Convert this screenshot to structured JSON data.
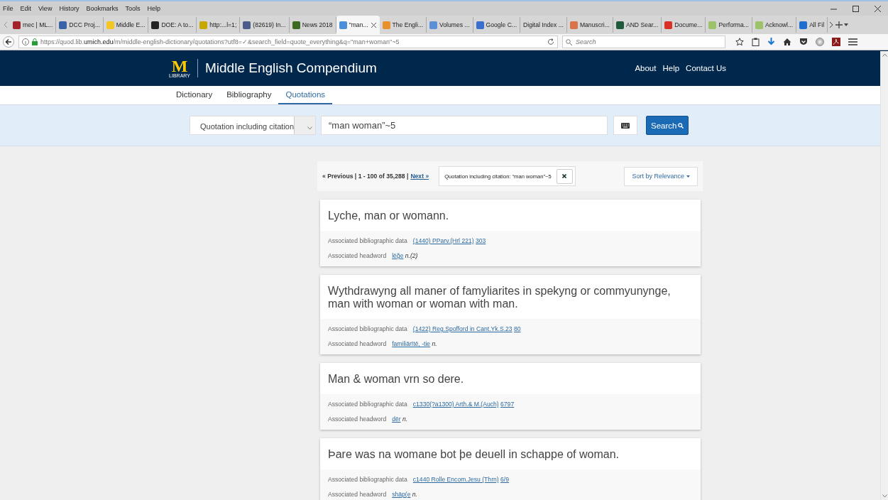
{
  "menu_bar": [
    "File",
    "Edit",
    "View",
    "History",
    "Bookmarks",
    "Tools",
    "Help"
  ],
  "browser_tabs": [
    {
      "label": "mec | ML...",
      "selected": false,
      "color": "#a3232b"
    },
    {
      "label": "DCC Proj...",
      "selected": false,
      "color": "#3a62a8"
    },
    {
      "label": "Middle E...",
      "selected": false,
      "color": "#f3c623"
    },
    {
      "label": "DOE: A to...",
      "selected": false,
      "color": "#222222"
    },
    {
      "label": "http:...l=1;",
      "selected": false,
      "color": "#c8a800"
    },
    {
      "label": "(82619) In...",
      "selected": false,
      "color": "#4a5c8c"
    },
    {
      "label": "News 2018",
      "selected": false,
      "color": "#3d6b1f"
    },
    {
      "label": "\"man...",
      "selected": true,
      "color": "#4a90d9"
    },
    {
      "label": "The Engli...",
      "selected": false,
      "color": "#e8902a"
    },
    {
      "label": "Volumes ...",
      "selected": false,
      "color": "#5b8fd6"
    },
    {
      "label": "Google C...",
      "selected": false,
      "color": "#3b6fcf"
    },
    {
      "label": "Digital Index ...",
      "selected": false
    },
    {
      "label": "Manuscri...",
      "selected": false,
      "color": "#d9734a"
    },
    {
      "label": "AND Sear...",
      "selected": false,
      "color": "#1f5a3a"
    },
    {
      "label": "Docume...",
      "selected": false,
      "color": "#d93025"
    },
    {
      "label": "Performa...",
      "selected": false,
      "color": "#9cc36a"
    },
    {
      "label": "Acknowl...",
      "selected": false,
      "color": "#9cc36a"
    },
    {
      "label": "All Fil",
      "selected": false,
      "color": "#1c6fd1"
    }
  ],
  "address_bar": {
    "url": "https://quod.lib.**umich.edu**/m/middle-english-dictionary/quotations?utf8=✓&search_field=quote_everything&q=\"man+woman\"~5"
  },
  "browser_search": {
    "placeholder": "Search"
  },
  "site_header": {
    "logo_letter": "M",
    "logo_caption": "LIBRARY",
    "title": "Middle English Compendium",
    "links": [
      "About",
      "Help",
      "Contact Us"
    ]
  },
  "site_nav": [
    {
      "label": "Dictionary",
      "selected": false
    },
    {
      "label": "Bibliography",
      "selected": false
    },
    {
      "label": "Quotations",
      "selected": true
    }
  ],
  "search": {
    "field_select": "Quotation including citation",
    "query": "“man woman”~5",
    "button": "Search"
  },
  "pager": {
    "status": "« Previous | 1 - 100 of 35,288 |",
    "next": "Next »",
    "filter": "Quotation including citation: “man woman”~5",
    "sort": "Sort by Relevance"
  },
  "results": [
    {
      "quote": "Lyche, man or womann.",
      "biblio_label": "Associated bibliographic data",
      "biblio_link": "(1440) PParv.(Hrl 221)",
      "biblio_page": "303",
      "headword_label": "Associated headword",
      "headword": "lēğe",
      "headword_pos": "n.(2)"
    },
    {
      "quote": "Wythdrawyng all maner of famyliarites in spekyng or commyunynge, man with woman or woman with man.",
      "biblio_label": "Associated bibliographic data",
      "biblio_link": "(1422) Reg.Spofford in Cant.Yk.S.23",
      "biblio_page": "80",
      "headword_label": "Associated headword",
      "headword": "familiārītē, -tie",
      "headword_pos": "n."
    },
    {
      "quote": "Man & woman vrn so dere.",
      "biblio_label": "Associated bibliographic data",
      "biblio_link": "c1330(?a1300) Arth.& M.(Auch)",
      "biblio_page": "6797",
      "headword_label": "Associated headword",
      "headword": "dēr",
      "headword_pos": "n."
    },
    {
      "quote": "Þare was na womane bot þe deuell in schappe of woman.",
      "biblio_label": "Associated bibliographic data",
      "biblio_link": "c1440 Rolle Encom.Jesu (Thrn)",
      "biblio_page": "6/9",
      "headword_label": "Associated headword",
      "headword": "shāp(e",
      "headword_pos": "n."
    }
  ]
}
